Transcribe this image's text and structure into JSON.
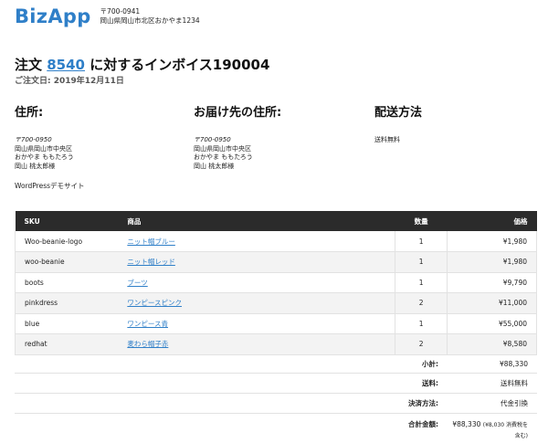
{
  "header": {
    "logo": "BizApp",
    "store_zip": "〒700-0941",
    "store_address": "岡山県岡山市北区おかやま1234"
  },
  "invoice": {
    "title_prefix": "注文",
    "order_number": "8540",
    "title_suffix": "に対するインボイス190004",
    "order_date": "ご注文日: 2019年12月11日"
  },
  "billing": {
    "heading": "住所:",
    "zip": "〒700-0950",
    "line1": "岡山県岡山市中央区",
    "line2": "おかやま ももたろう",
    "line3": "岡山 桃太郎様"
  },
  "shipping": {
    "heading": "お届け先の住所:",
    "zip": "〒700-0950",
    "line1": "岡山県岡山市中央区",
    "line2": "おかやま ももたろう",
    "line3": "岡山 桃太郎様"
  },
  "delivery": {
    "heading": "配送方法",
    "value": "送料無料"
  },
  "site_name": "WordPressデモサイト",
  "table": {
    "headers": {
      "sku": "SKU",
      "product": "商品",
      "qty": "数量",
      "price": "価格"
    },
    "rows": [
      {
        "sku": "Woo-beanie-logo",
        "product": "ニット帽ブルー",
        "qty": "1",
        "price": "¥1,980"
      },
      {
        "sku": "woo-beanie",
        "product": "ニット帽レッド",
        "qty": "1",
        "price": "¥1,980"
      },
      {
        "sku": "boots",
        "product": "ブーツ",
        "qty": "1",
        "price": "¥9,790"
      },
      {
        "sku": "pinkdress",
        "product": "ワンピースピンク",
        "qty": "2",
        "price": "¥11,000"
      },
      {
        "sku": "blue",
        "product": "ワンピース青",
        "qty": "1",
        "price": "¥55,000"
      },
      {
        "sku": "redhat",
        "product": "麦わら帽子赤",
        "qty": "2",
        "price": "¥8,580"
      }
    ]
  },
  "totals": {
    "subtotal_label": "小計:",
    "subtotal_value": "¥88,330",
    "shipping_label": "送料:",
    "shipping_value": "送料無料",
    "payment_label": "決済方法:",
    "payment_value": "代金引換",
    "total_label": "合計金額:",
    "total_value": "¥88,330",
    "total_note": "(¥8,030 消費税を含む)"
  }
}
